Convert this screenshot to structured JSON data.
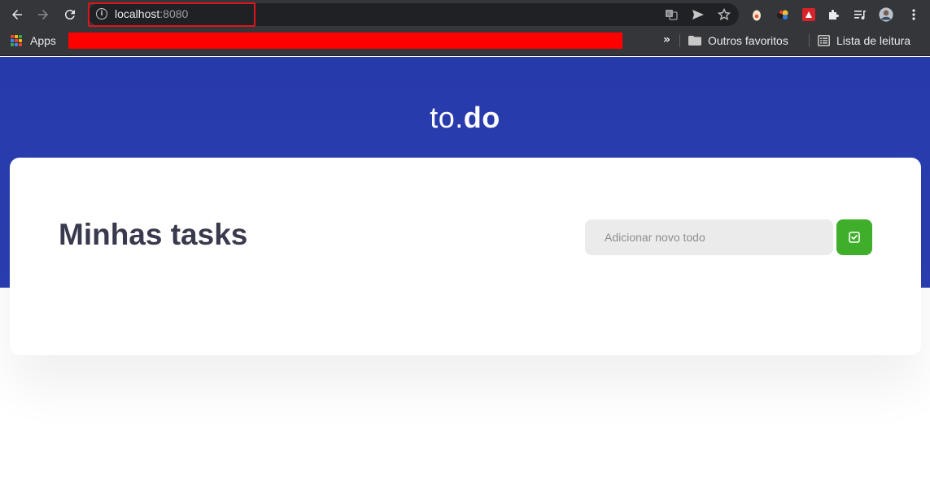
{
  "browser": {
    "url_host": "localhost",
    "url_port": ":8080",
    "bookmarks": {
      "apps_label": "Apps",
      "more_chevron": "»",
      "other_favorites_label": "Outros favoritos",
      "reading_list_label": "Lista de leitura"
    },
    "icons": [
      "back-icon",
      "forward-icon",
      "reload-icon",
      "info-icon",
      "translate-icon",
      "send-icon",
      "star-icon",
      "extension-icon",
      "puzzle-icon",
      "media-icon",
      "profile-avatar",
      "menu-icon"
    ],
    "colors": {
      "highlight": "#e0141b",
      "redaction": "#ff0000"
    }
  },
  "app": {
    "logo_light": "to.",
    "logo_bold": "do",
    "title": "Minhas tasks",
    "new_todo_placeholder": "Adicionar novo todo",
    "add_button_icon": "checkbox-icon",
    "colors": {
      "hero": "#2b3fb2",
      "accent": "#3fae2a",
      "title": "#3a3a4e"
    }
  }
}
